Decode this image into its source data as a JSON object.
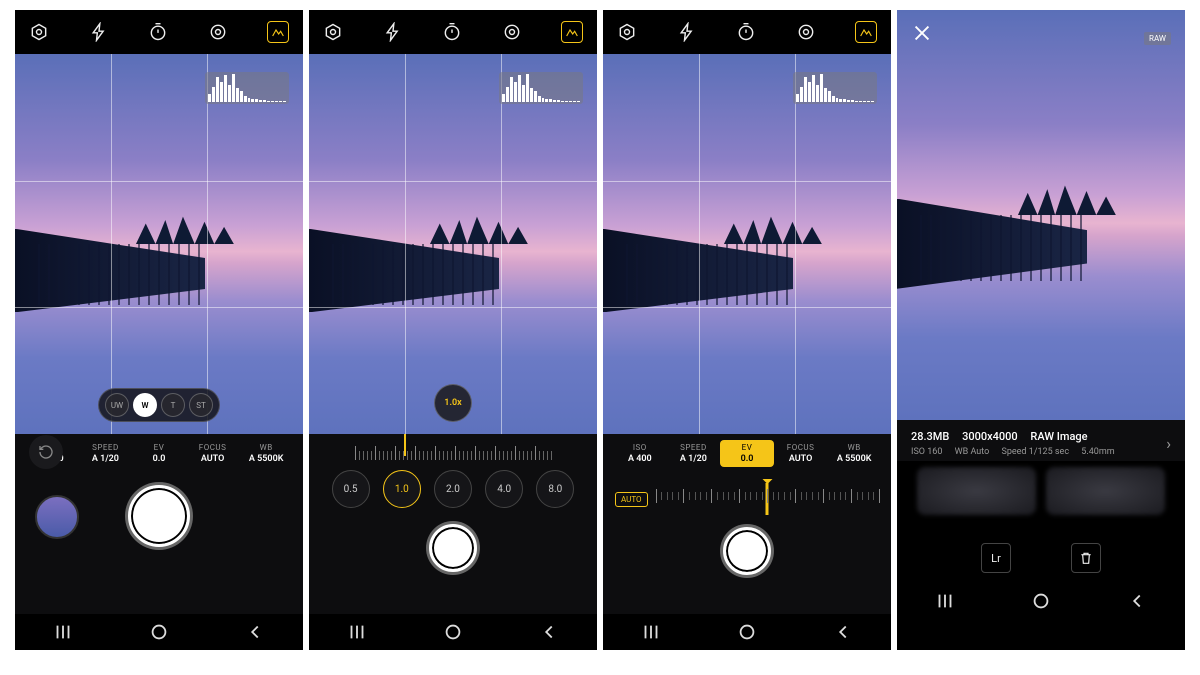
{
  "top_icons": [
    "settings",
    "flash",
    "timer",
    "metering",
    "filter"
  ],
  "lens": {
    "options": [
      "UW",
      "W",
      "T",
      "ST"
    ],
    "active": 1
  },
  "manual": {
    "iso": {
      "label": "ISO",
      "value": "A 400"
    },
    "speed": {
      "label": "SPEED",
      "value": "A 1/20"
    },
    "ev": {
      "label": "EV",
      "value": "0.0"
    },
    "focus": {
      "label": "FOCUS",
      "value": "AUTO"
    },
    "wb": {
      "label": "WB",
      "value": "A 5500K"
    }
  },
  "zoom": {
    "current": "1.0x",
    "presets": [
      "0.5",
      "1.0",
      "2.0",
      "4.0",
      "8.0"
    ],
    "active_preset": 1
  },
  "ev_control": {
    "auto_label": "AUTO",
    "value": "0.0"
  },
  "review": {
    "raw_badge": "RAW",
    "size": "28.3MB",
    "resolution": "3000x4000",
    "format": "RAW Image",
    "meta_iso": "ISO 160",
    "meta_wb": "WB Auto",
    "meta_speed": "Speed 1/125 sec",
    "meta_focal": "5.40mm",
    "edit_app": "Lr"
  },
  "histogram_bars": [
    30,
    55,
    90,
    70,
    95,
    60,
    100,
    50,
    40,
    20,
    15,
    10,
    12,
    8,
    6,
    5,
    4,
    3,
    2,
    2
  ],
  "nav": [
    "recents",
    "home",
    "back"
  ]
}
